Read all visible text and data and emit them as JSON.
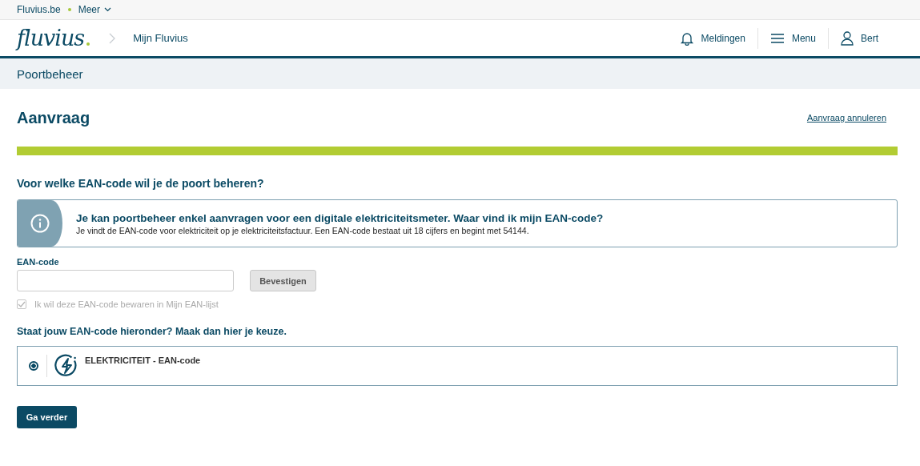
{
  "top_bar": {
    "site_link": "Fluvius.be",
    "more_menu": "Meer"
  },
  "header": {
    "logo": "fluvius",
    "breadcrumb": "Mijn Fluvius",
    "actions": [
      {
        "kind": "bell",
        "label": "Meldingen"
      },
      {
        "kind": "menu",
        "label": "Menu"
      },
      {
        "kind": "user",
        "label": "Bert"
      }
    ]
  },
  "subheader": {
    "title": "Poortbeheer"
  },
  "page": {
    "title": "Aanvraag",
    "cancel_link": "Aanvraag annuleren",
    "progress": {
      "level": 1
    }
  },
  "question": "Voor welke EAN-code wil je de poort beheren?",
  "info": {
    "title": "Je kan poortbeheer enkel aanvragen voor een digitale elektriciteitsmeter. Waar vind ik mijn EAN-code?",
    "text": "Je vindt de EAN-code voor elektriciteit op je elektriciteitsfactuur. Een EAN-code bestaat uit 18 cijfers en begint met 54144."
  },
  "ean_field": {
    "label": "EAN-code",
    "confirm_button": "Bevestigen",
    "save_checkbox": {
      "label": "Ik wil deze EAN-code bewaren in Mijn EAN-lijst",
      "checked": true,
      "disabled": true
    }
  },
  "choice_heading": "Staat jouw EAN-code hieronder? Maak dan hier je keuze.",
  "options": [
    {
      "label": "ELEKTRICITEIT - EAN-code",
      "selected": true
    }
  ],
  "continue_button": "Ga verder"
}
